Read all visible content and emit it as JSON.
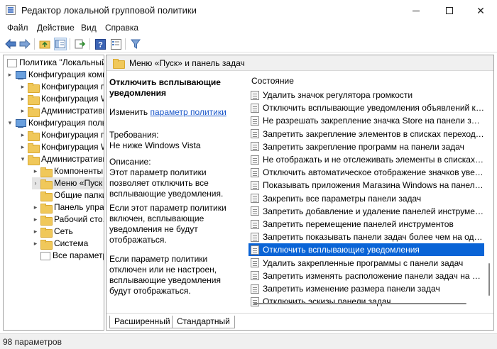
{
  "window": {
    "title": "Редактор локальной групповой политики"
  },
  "menu": [
    "Файл",
    "Действие",
    "Вид",
    "Справка"
  ],
  "toolbar": {
    "icons": [
      "back-arrow-icon",
      "forward-arrow-icon",
      "up-folder-icon",
      "show-hide-tree-icon",
      "export-list-icon",
      "help-icon",
      "properties-icon",
      "filter-icon"
    ]
  },
  "tree": [
    {
      "label": "Политика \"Локальный",
      "icon": "doc",
      "arrow": ""
    },
    {
      "label": "Конфигурация комп",
      "icon": "pc",
      "arrow": "▸"
    },
    {
      "label": "Конфигурация п",
      "icon": "folder",
      "arrow": "▸"
    },
    {
      "label": "Конфигурация W",
      "icon": "folder",
      "arrow": "▸"
    },
    {
      "label": "Административн",
      "icon": "folder",
      "arrow": "▸"
    },
    {
      "label": "Конфигурация поль",
      "icon": "pc",
      "arrow": "▾"
    },
    {
      "label": "Конфигурация п",
      "icon": "folder",
      "arrow": "▸"
    },
    {
      "label": "Конфигурация W",
      "icon": "folder",
      "arrow": "▸"
    },
    {
      "label": "Административн",
      "icon": "folder",
      "arrow": "▾"
    },
    {
      "label": "Компоненты",
      "icon": "folder",
      "arrow": "▸"
    },
    {
      "label": "Меню «Пуск",
      "icon": "folder",
      "arrow": "",
      "selected": true
    },
    {
      "label": "Общие папки",
      "icon": "folder",
      "arrow": ""
    },
    {
      "label": "Панель упра",
      "icon": "folder",
      "arrow": "▸"
    },
    {
      "label": "Рабочий сто.",
      "icon": "folder",
      "arrow": "▸"
    },
    {
      "label": "Сеть",
      "icon": "folder",
      "arrow": "▸"
    },
    {
      "label": "Система",
      "icon": "folder",
      "arrow": "▸"
    },
    {
      "label": "Все параметр",
      "icon": "doc",
      "arrow": ""
    }
  ],
  "right": {
    "header": "Меню «Пуск» и панель задач",
    "description": {
      "title": "Отключить всплывающие уведомления",
      "edit_prefix": "Изменить",
      "edit_link": "параметр политики",
      "requirements_label": "Требования:",
      "requirements_value": "Не ниже Windows Vista",
      "description_label": "Описание:",
      "description_text": "Этот параметр политики позволяет отключить все всплывающие уведомления.",
      "enabled_text": "Если этот параметр политики включен, всплывающие уведомления не будут отображаться.",
      "disabled_text": "Если параметр политики отключен или не настроен, всплывающие уведомления будут отображаться."
    },
    "column_header": "Состояние",
    "policies": [
      "Удалить значок регулятора громкости",
      "Отключить всплывающие уведомления объявлений ком...",
      "Не разрешать закрепление значка Store на панели задач",
      "Запретить закрепление элементов в списках переходов",
      "Запретить закрепление программ на панели задач",
      "Не отображать и не отслеживать элементы в списках пе...",
      "Отключить автоматическое отображение значков уведо...",
      "Показывать приложения Магазина Windows на панели з...",
      "Закрепить все параметры панели задач",
      "Запретить добавление и удаление панелей инструментов",
      "Запретить перемещение панелей инструментов",
      "Запретить показывать панели задач более чем на одном ...",
      "Отключить всплывающие уведомления",
      "Удалить закрепленные программы с панели задач",
      "Запретить изменять расположение панели задач на экра...",
      "Запретить изменение размера панели задач",
      "Отключить эскизы панели задач"
    ],
    "selected_index": 12,
    "tabs": [
      "Расширенный",
      "Стандартный"
    ]
  },
  "status": {
    "text": "98 параметров"
  }
}
